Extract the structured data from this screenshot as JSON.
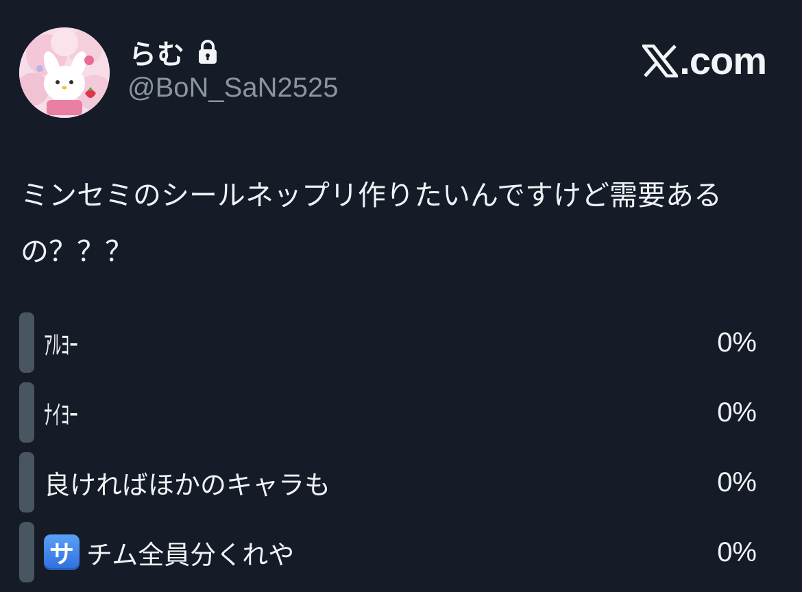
{
  "user": {
    "display_name": "らむ",
    "handle": "@BoN_SaN2525",
    "protected_icon": "lock-icon",
    "avatar_icon": "character-avatar"
  },
  "brand": {
    "logo_icon": "x-logo-icon",
    "text": ".com"
  },
  "tweet": {
    "text": "ミンセミのシールネップリ作りたいんですけど需要あるの？？？"
  },
  "poll": {
    "options": [
      {
        "label": "ｱﾙﾖｰ",
        "percent": "0%",
        "value": 0
      },
      {
        "label": "ﾅｲﾖｰ",
        "percent": "0%",
        "value": 0
      },
      {
        "label": "良ければほかのキャラも",
        "percent": "0%",
        "value": 0
      },
      {
        "label": "チム全員分くれや",
        "badge": "サ",
        "percent": "0%",
        "value": 0
      }
    ]
  },
  "colors": {
    "background": "#151c27",
    "poll_bar": "#4a5562",
    "handle": "#8b95a2",
    "badge": "#3d82ea"
  }
}
